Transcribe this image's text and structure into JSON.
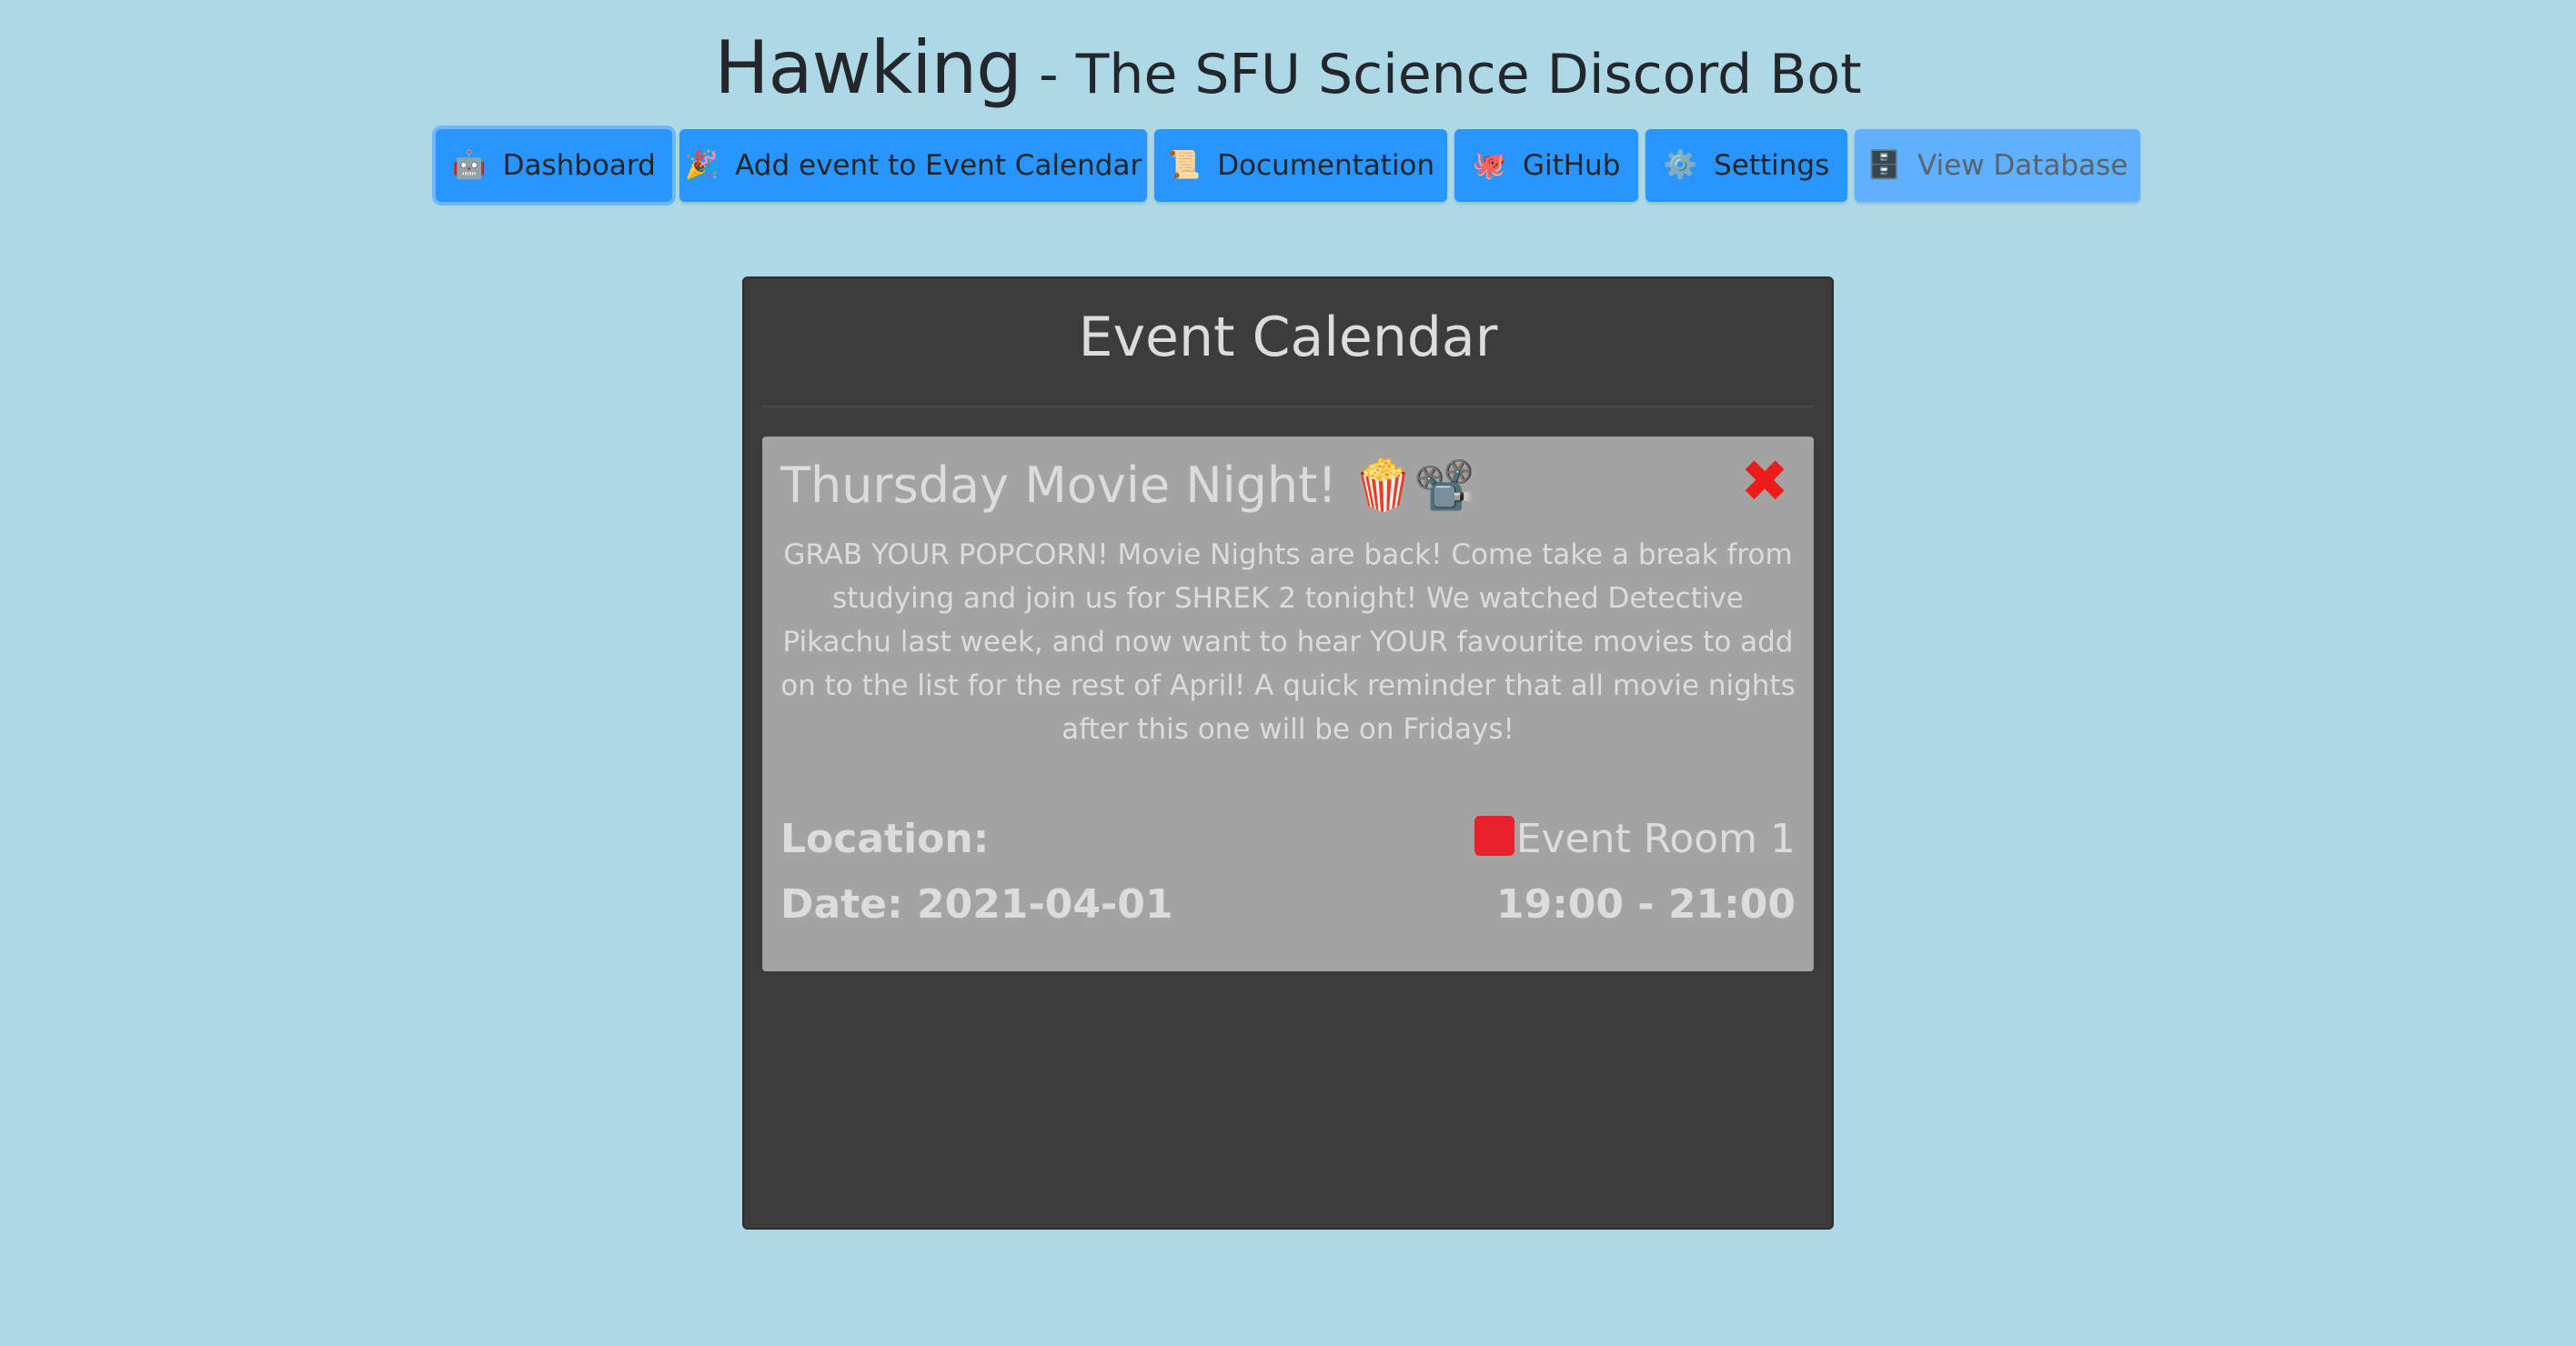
{
  "header": {
    "brand": "Hawking",
    "tagline": " - The SFU Science Discord Bot"
  },
  "nav": {
    "items": [
      {
        "icon": "🤖",
        "icon_name": "robot-icon",
        "label": "Dashboard"
      },
      {
        "icon": "🎉",
        "icon_name": "party-popper-icon",
        "label": "Add event to Event Calendar"
      },
      {
        "icon": "📜",
        "icon_name": "scroll-icon",
        "label": "Documentation"
      },
      {
        "icon": "🐙",
        "icon_name": "octopus-icon",
        "label": "GitHub"
      },
      {
        "icon": "⚙️",
        "icon_name": "gear-icon",
        "label": "Settings"
      },
      {
        "icon": "🗄️",
        "icon_name": "file-cabinet-icon",
        "label": "View Database"
      }
    ],
    "active": "Dashboard",
    "disabled": "View Database"
  },
  "calendar": {
    "title": "Event Calendar",
    "events": [
      {
        "title": "Thursday Movie Night! 🍿📽️",
        "close_icon": "✖",
        "description": "GRAB YOUR POPCORN! Movie Nights are back! Come take a break from studying and join us for SHREK 2 tonight! We watched Detective Pikachu last week, and now want to hear YOUR favourite movies to add on to the list for the rest of April! A quick reminder that all movie nights after this one will be on Fridays!",
        "location_label": "Location:",
        "location": "Event Room 1",
        "date_label": "Date: 2021-04-01",
        "time": "19:00 - 21:00"
      }
    ]
  },
  "colors": {
    "background": "#add8e6",
    "button": "#2996ff",
    "button_disabled": "#5fb0ff",
    "panel": "#3c3c3c",
    "card": "#a3a3a3",
    "close": "#ee1b1b",
    "room_marker": "#e8202a"
  }
}
